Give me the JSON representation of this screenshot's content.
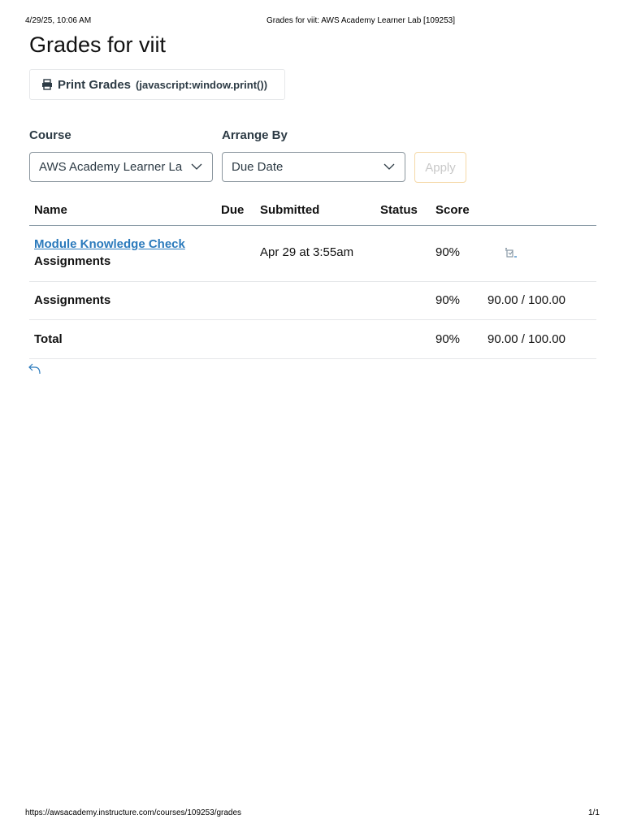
{
  "print_header": {
    "datetime": "4/29/25, 10:06 AM",
    "title": "Grades for viit: AWS Academy Learner Lab [109253]"
  },
  "page_title": "Grades for viit",
  "print_button": {
    "label": "Print Grades",
    "hint": "(javascript:window.print())"
  },
  "filters": {
    "course_label": "Course",
    "course_value": "AWS Academy Learner La",
    "arrange_label": "Arrange By",
    "arrange_value": "Due Date",
    "apply_label": "Apply"
  },
  "table": {
    "headers": {
      "name": "Name",
      "due": "Due",
      "submitted": "Submitted",
      "status": "Status",
      "score": "Score"
    },
    "rows": [
      {
        "name": "Module Knowledge Check",
        "group": "Assignments",
        "due": "",
        "submitted": "Apr 29 at 3:55am",
        "status": "",
        "score": "90%",
        "points": ""
      },
      {
        "name": "Assignments",
        "score": "90%",
        "points": "90.00 / 100.00"
      },
      {
        "name": "Total",
        "score": "90%",
        "points": "90.00 / 100.00"
      }
    ]
  },
  "footer": {
    "url": "https://awsacademy.instructure.com/courses/109253/grades",
    "page": "1/1"
  },
  "colors": {
    "link": "#2b7abc",
    "text": "#2d3b45"
  }
}
